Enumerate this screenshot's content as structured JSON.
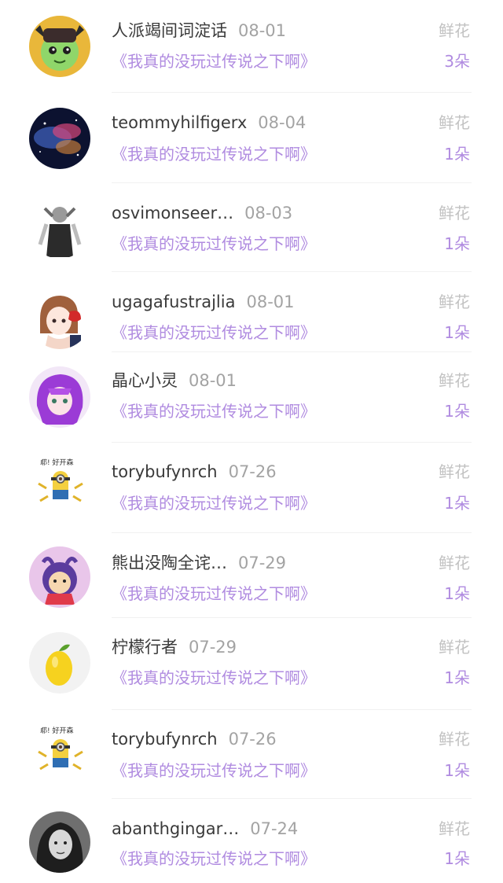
{
  "items": [
    {
      "name": "人派竭间词淀话",
      "date": "08-01",
      "title": "《我真的没玩过传说之下啊》",
      "gift": "鲜花",
      "count": "3朵",
      "avatar": "goblin-avatar"
    },
    {
      "name": "teommyhilfigerx",
      "date": "08-04",
      "title": "《我真的没玩过传说之下啊》",
      "gift": "鲜花",
      "count": "1朵",
      "avatar": "galaxy-avatar"
    },
    {
      "name": "osvimonseer…",
      "date": "08-03",
      "title": "《我真的没玩过传说之下啊》",
      "gift": "鲜花",
      "count": "1朵",
      "avatar": "person-bw-avatar"
    },
    {
      "name": "ugagafustrajlia",
      "date": "08-01",
      "title": "《我真的没玩过传说之下啊》",
      "gift": "鲜花",
      "count": "1朵",
      "avatar": "anime-girl-red-avatar"
    },
    {
      "name": "晶心小灵",
      "date": "08-01",
      "title": "《我真的没玩过传说之下啊》",
      "gift": "鲜花",
      "count": "1朵",
      "avatar": "anime-girl-purple-avatar"
    },
    {
      "name": "torybufynrch",
      "date": "07-26",
      "title": "《我真的没玩过传说之下啊》",
      "gift": "鲜花",
      "count": "1朵",
      "avatar": "minion-avatar"
    },
    {
      "name": "熊出没陶全诧…",
      "date": "07-29",
      "title": "《我真的没玩过传说之下啊》",
      "gift": "鲜花",
      "count": "1朵",
      "avatar": "cartoon-pink-avatar"
    },
    {
      "name": "柠檬行者",
      "date": "07-29",
      "title": "《我真的没玩过传说之下啊》",
      "gift": "鲜花",
      "count": "1朵",
      "avatar": "lemon-avatar"
    },
    {
      "name": "torybufynrch",
      "date": "07-26",
      "title": "《我真的没玩过传说之下啊》",
      "gift": "鲜花",
      "count": "1朵",
      "avatar": "minion-avatar"
    },
    {
      "name": "abanthgingar…",
      "date": "07-24",
      "title": "《我真的没玩过传说之下啊》",
      "gift": "鲜花",
      "count": "1朵",
      "avatar": "woman-photo-avatar"
    }
  ],
  "colors": {
    "name": "#3a3a3a",
    "date": "#a3a3a3",
    "title": "#b08be0",
    "gift_label": "#c2c2c2",
    "count": "#b08be0"
  }
}
